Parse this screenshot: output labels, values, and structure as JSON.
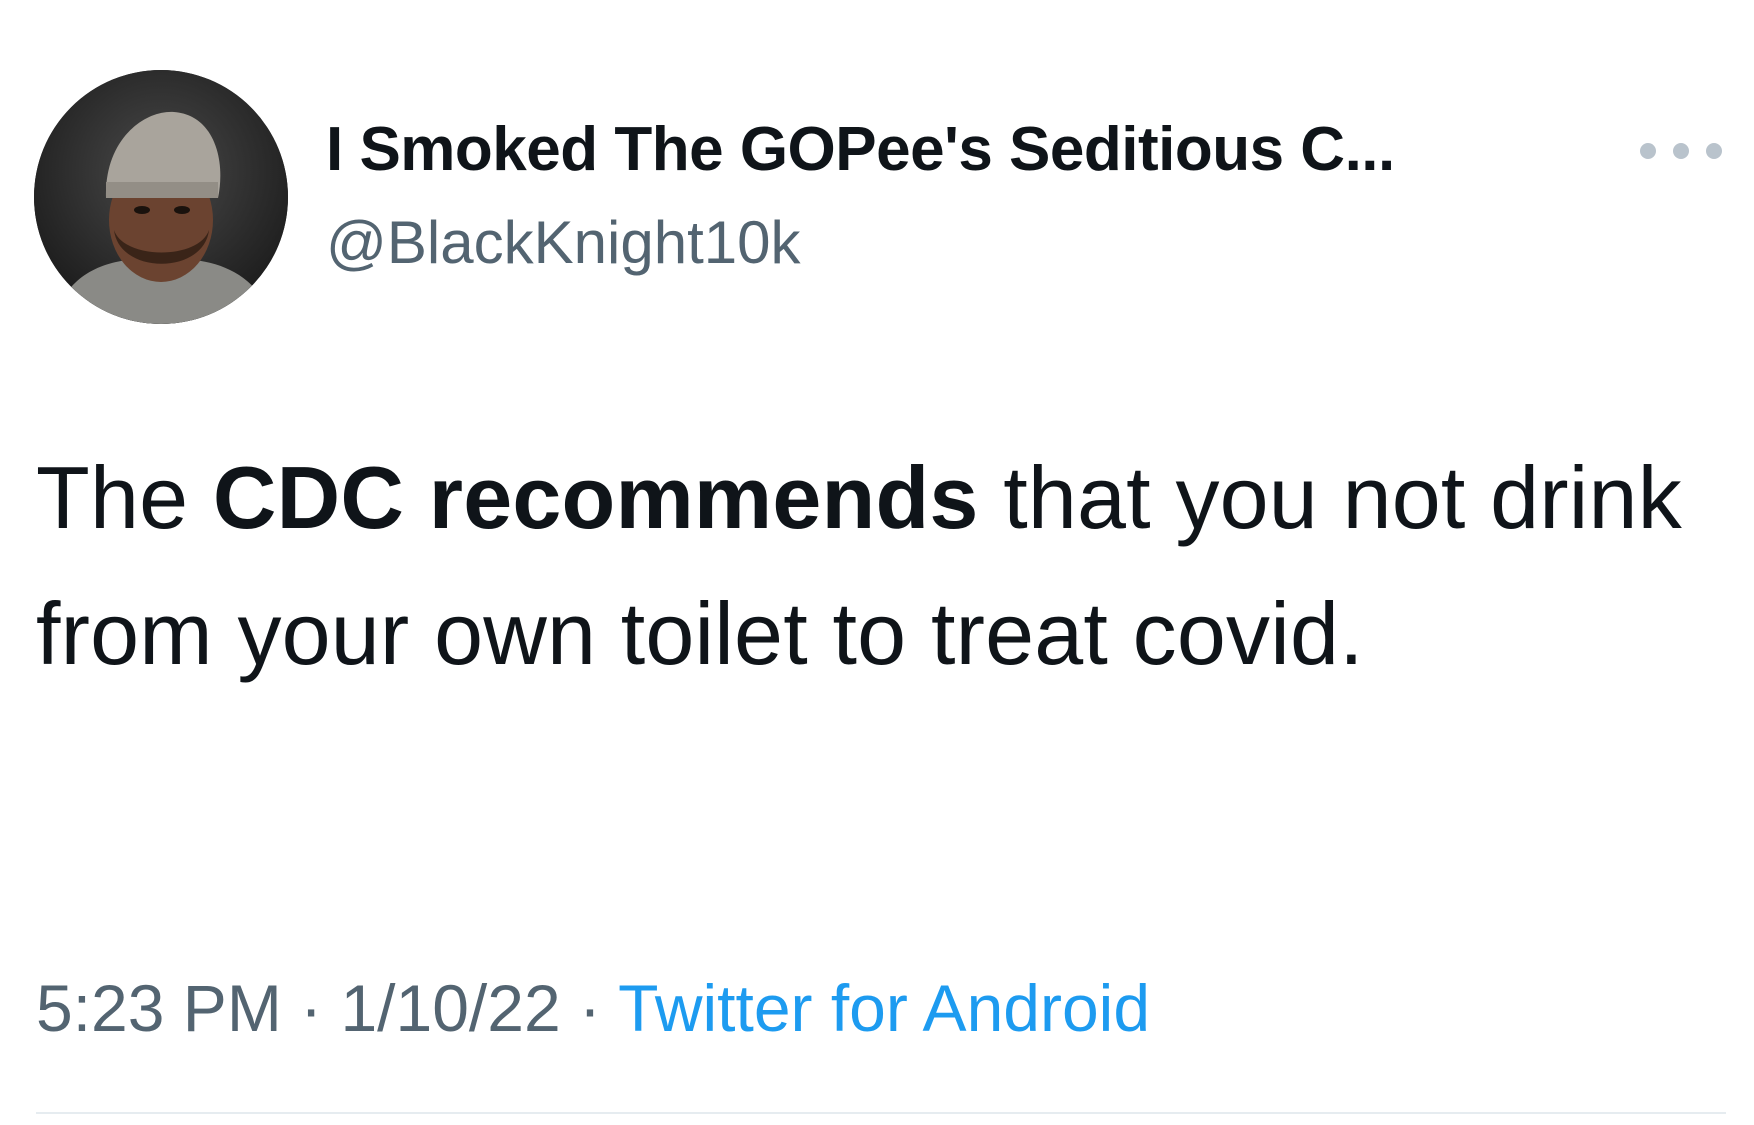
{
  "author": {
    "display_name": "I Smoked The GOPee's Seditious C...",
    "handle": "@BlackKnight10k",
    "avatar": "profile-photo"
  },
  "more_icon": "more-horizontal-icon",
  "tweet": {
    "text_part1": "The ",
    "text_bold": "CDC recommends",
    "text_part2": " that you not drink from your own toilet to treat covid."
  },
  "meta": {
    "time": "5:23 PM",
    "separator1": " · ",
    "date": "1/10/22",
    "separator2": " · ",
    "source": "Twitter for Android"
  },
  "colors": {
    "text": "#0f1419",
    "secondary": "#536471",
    "link": "#1d9bf0",
    "divider": "#e6ecf0"
  }
}
